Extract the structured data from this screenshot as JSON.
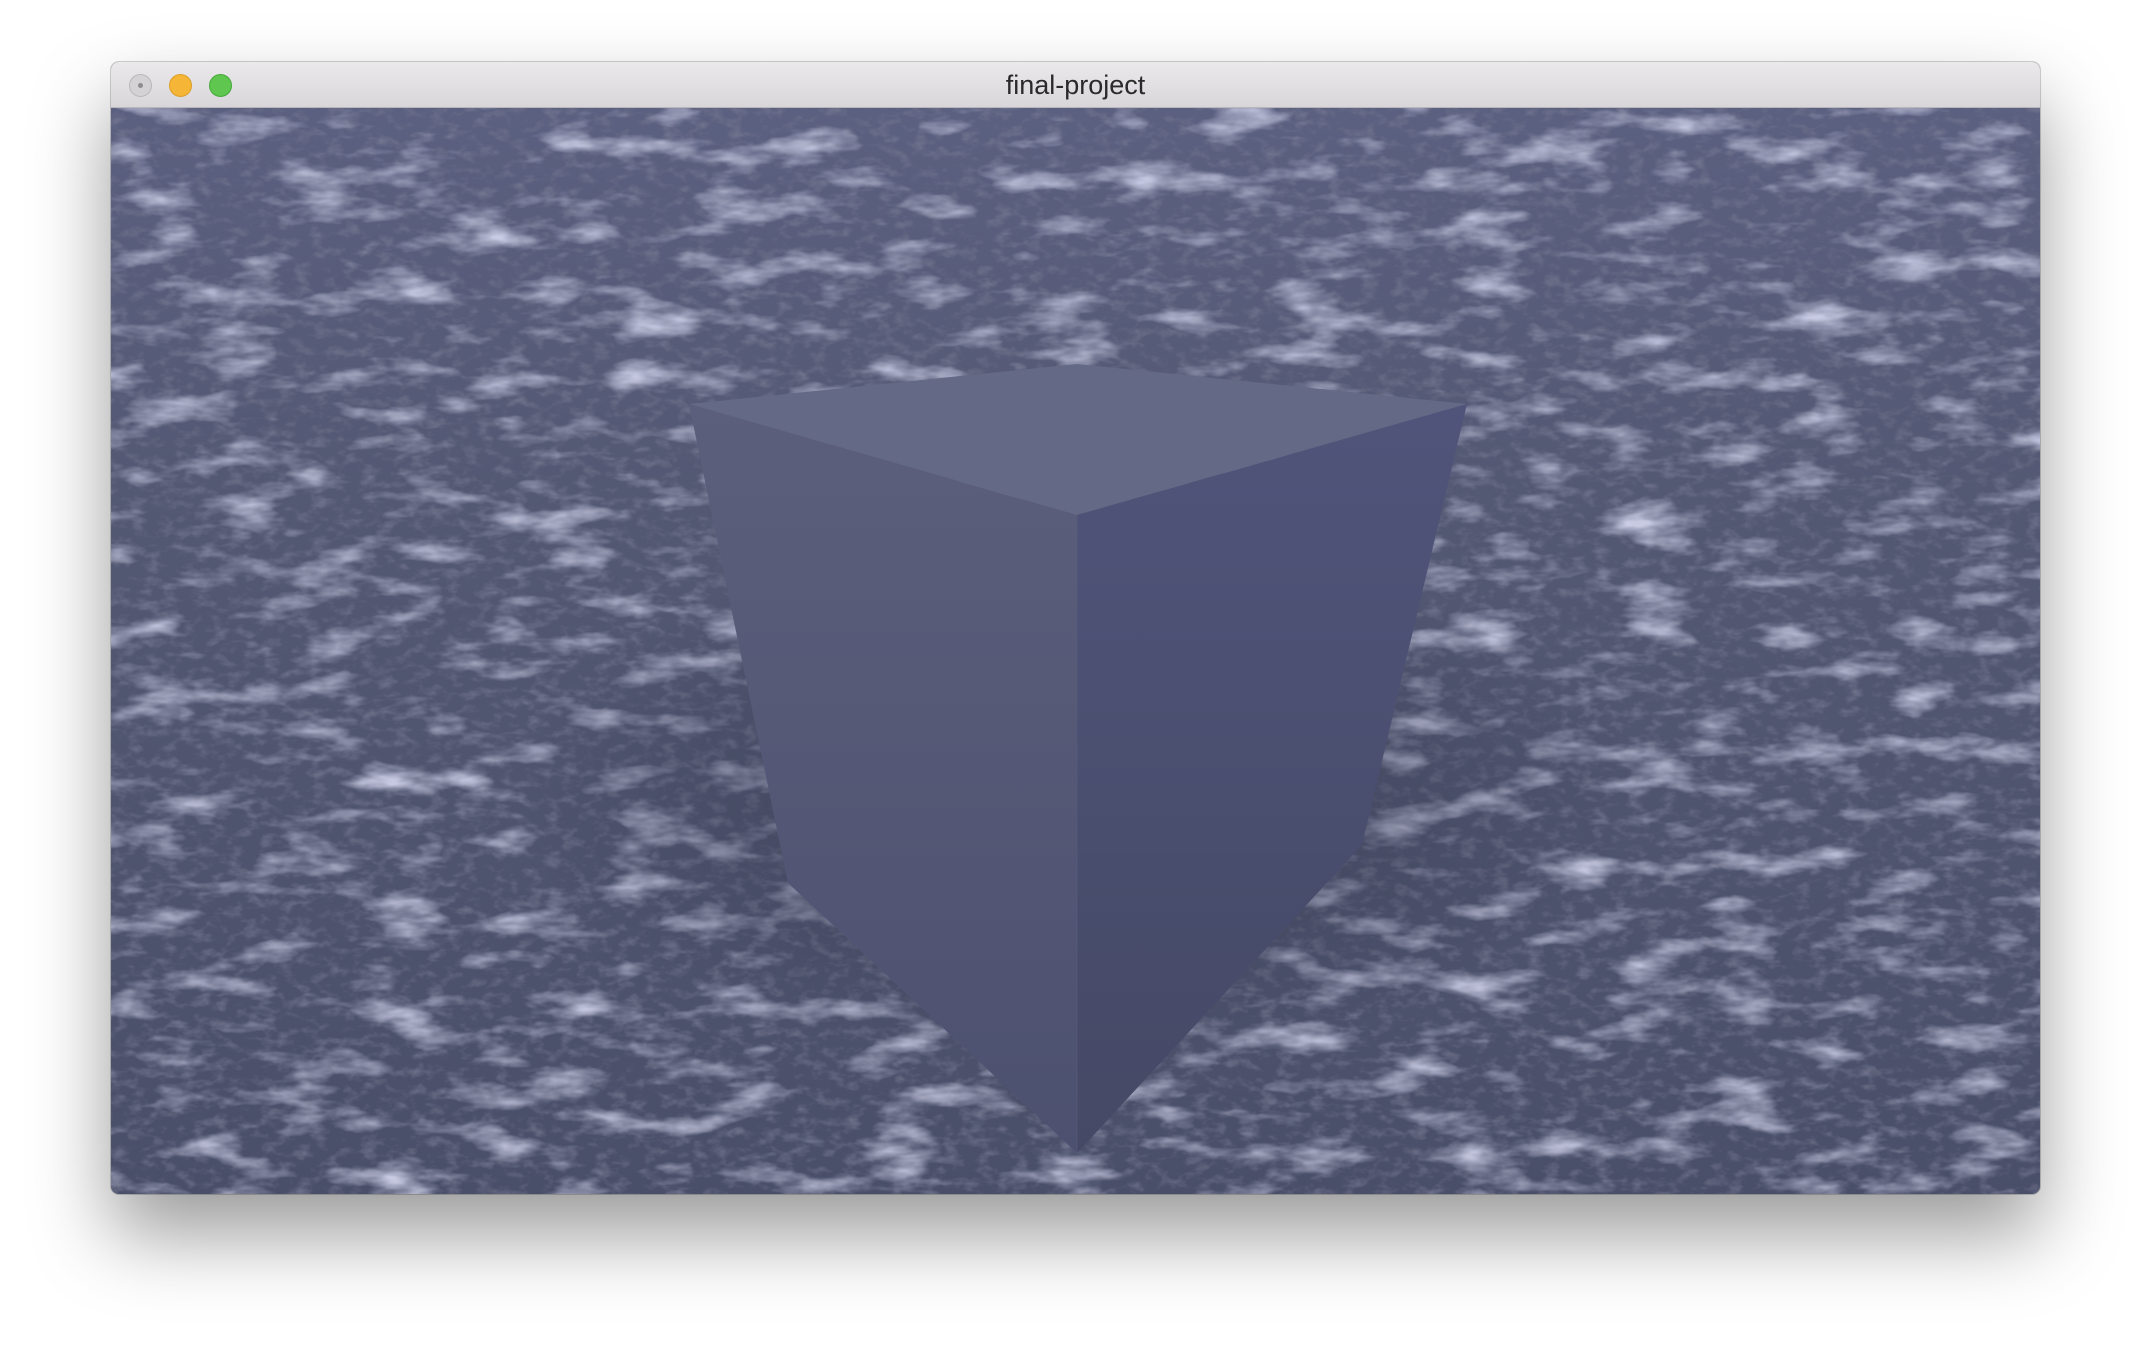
{
  "window": {
    "title": "final-project",
    "controls": [
      "close-icon",
      "minimize-icon",
      "zoom-icon"
    ]
  },
  "scene": {
    "object": "cube",
    "background": "rocky-terrain-skybox",
    "colors": {
      "cube_top": "#646985",
      "cube_left": "#575b76",
      "cube_right": "#4d5170",
      "terrain_base": "#4f5470",
      "terrain_highlight": "#b5b8e3"
    }
  }
}
